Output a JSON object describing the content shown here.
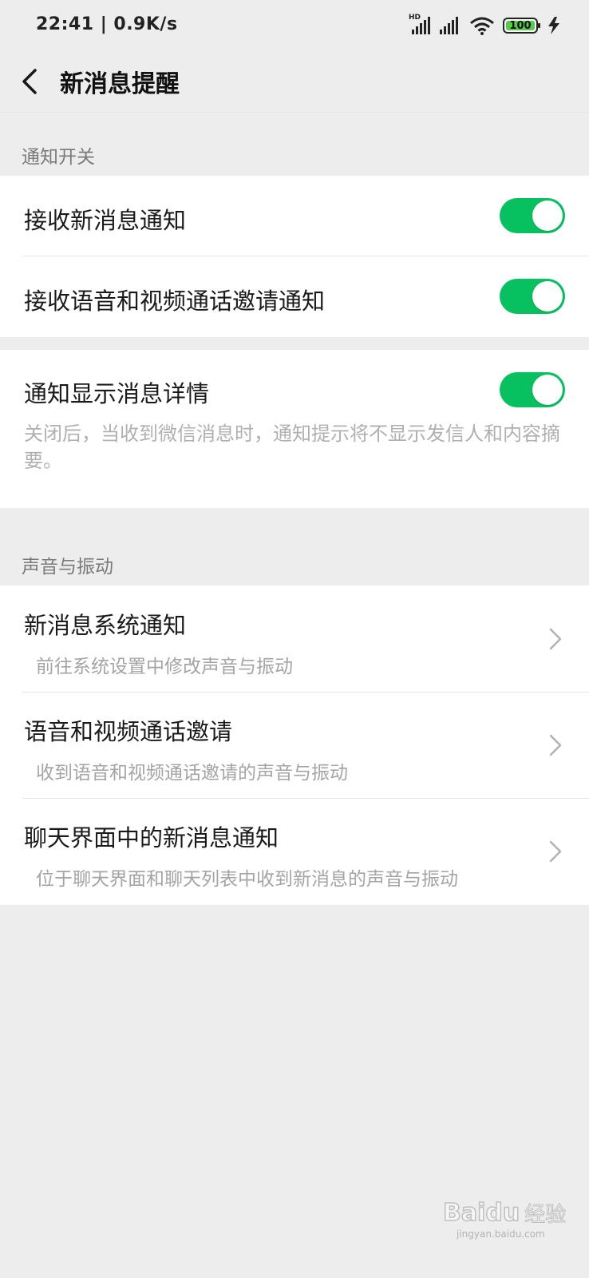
{
  "status_bar": {
    "time": "22:41",
    "speed": "0.9K/s",
    "network_label": "HD",
    "battery": "100",
    "icons": [
      "hd-signal-icon",
      "signal-icon",
      "wifi-icon",
      "battery-icon",
      "charging-icon"
    ]
  },
  "nav": {
    "title": "新消息提醒",
    "back_icon": "chevron-left-icon"
  },
  "sections": {
    "notify_switch": {
      "header": "通知开关",
      "items": [
        {
          "label": "接收新消息通知",
          "enabled": true
        },
        {
          "label": "接收语音和视频通话邀请通知",
          "enabled": true
        }
      ]
    },
    "detail": {
      "label": "通知显示消息详情",
      "enabled": true,
      "description": "关闭后，当收到微信消息时，通知提示将不显示发信人和内容摘要。"
    },
    "sound_vibration": {
      "header": "声音与振动",
      "items": [
        {
          "label": "新消息系统通知",
          "sub": "前往系统设置中修改声音与振动"
        },
        {
          "label": "语音和视频通话邀请",
          "sub": "收到语音和视频通话邀请的声音与振动"
        },
        {
          "label": "聊天界面中的新消息通知",
          "sub": "位于聊天界面和聊天列表中收到新消息的声音与振动"
        }
      ]
    }
  },
  "colors": {
    "accent": "#07c160",
    "background": "#ededed",
    "card": "#ffffff"
  },
  "watermark": {
    "brand": "Baidu",
    "suffix": "经验",
    "url": "jingyan.baidu.com"
  }
}
